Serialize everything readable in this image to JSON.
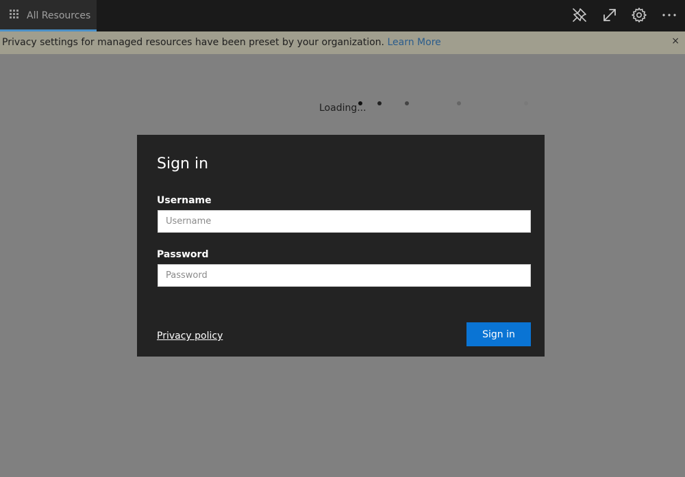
{
  "topbar": {
    "tab_label": "All Resources",
    "icons": [
      "apps-grid-icon",
      "pin-icon",
      "expand-icon",
      "gear-icon",
      "more-icon"
    ]
  },
  "banner": {
    "message": "Privacy settings for managed resources have been preset by your organization. ",
    "link_text": "Learn More",
    "close_glyph": "×"
  },
  "loading": {
    "text": "Loading..."
  },
  "dialog": {
    "title": "Sign in",
    "username_label": "Username",
    "username_placeholder": "Username",
    "username_value": "",
    "password_label": "Password",
    "password_placeholder": "Password",
    "password_value": "",
    "privacy_link": "Privacy policy",
    "signin_button": "Sign in"
  },
  "colors": {
    "accent": "#0a74d4",
    "dialog_bg": "#232323",
    "topbar_bg": "#1a1a1a",
    "overlay": "#808080",
    "banner_bg": "#a09e8e",
    "link": "#2a5c8c"
  }
}
